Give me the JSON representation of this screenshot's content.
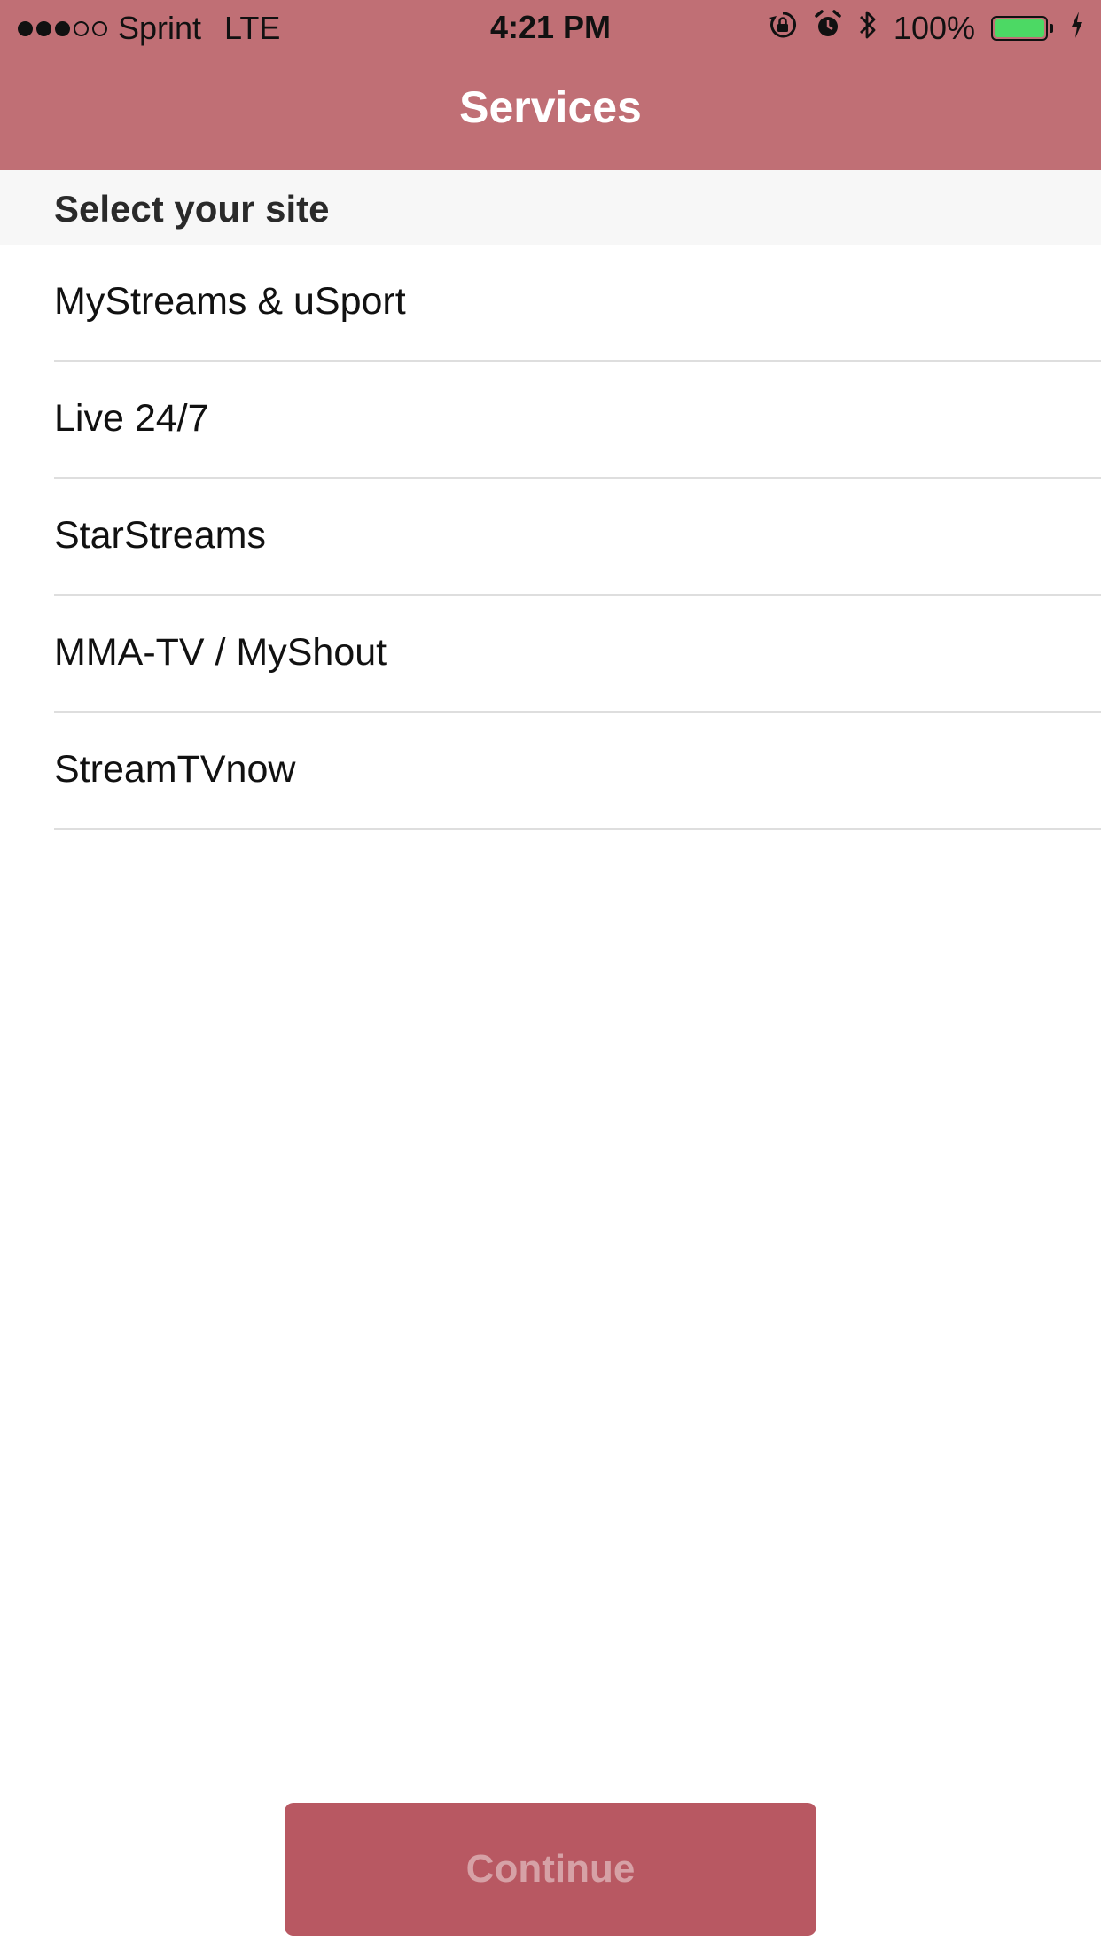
{
  "status_bar": {
    "signal_strength": "3 of 5",
    "carrier": "Sprint",
    "network": "LTE",
    "time": "4:21 PM",
    "battery_percent": "100%",
    "battery_level": 1.0,
    "battery_color": "#4cd964",
    "icons": [
      "rotation-lock-icon",
      "alarm-icon",
      "bluetooth-icon",
      "battery-icon",
      "charging-bolt-icon"
    ]
  },
  "nav": {
    "title": "Services",
    "bar_color": "#c06f75"
  },
  "section": {
    "header": "Select your site"
  },
  "sites": [
    {
      "label": "MyStreams & uSport"
    },
    {
      "label": "Live 24/7"
    },
    {
      "label": "StarStreams"
    },
    {
      "label": "MMA-TV / MyShout"
    },
    {
      "label": "StreamTVnow"
    }
  ],
  "footer": {
    "continue_label": "Continue",
    "button_color": "#b85862"
  }
}
